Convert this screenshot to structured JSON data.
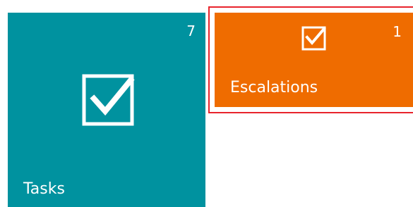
{
  "tiles": {
    "tasks": {
      "label": "Tasks",
      "count": "7",
      "icon": "checkbox-checked-icon",
      "color": "#00929f"
    },
    "escalations": {
      "label": "Escalations",
      "count": "1",
      "icon": "checkbox-checked-icon",
      "color": "#ef6c00",
      "selected": true
    }
  },
  "colors": {
    "selection_outline": "#e8242c",
    "text": "#ffffff"
  }
}
